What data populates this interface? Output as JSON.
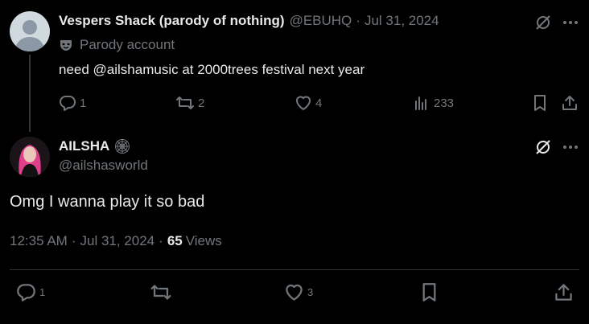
{
  "parent_tweet": {
    "display_name": "Vespers Shack (parody of nothing)",
    "handle": "@EBUHQ",
    "separator": "·",
    "date": "Jul 31, 2024",
    "parody_label": "Parody account",
    "text": "need @ailshamusic at 2000trees festival next year",
    "replies": "1",
    "reposts": "2",
    "likes": "4",
    "views": "233"
  },
  "main_tweet": {
    "display_name": "AILSHA",
    "handle": "@ailshasworld",
    "text": "Omg I wanna play it so bad",
    "time": "12:35 AM",
    "separator": "·",
    "date": "Jul 31, 2024",
    "views_count": "65",
    "views_label": "Views",
    "replies": "1",
    "likes": "3"
  },
  "colors": {
    "background": "#000000",
    "text_primary": "#e7e9ea",
    "text_muted": "#71767b",
    "divider": "#2f3336"
  }
}
